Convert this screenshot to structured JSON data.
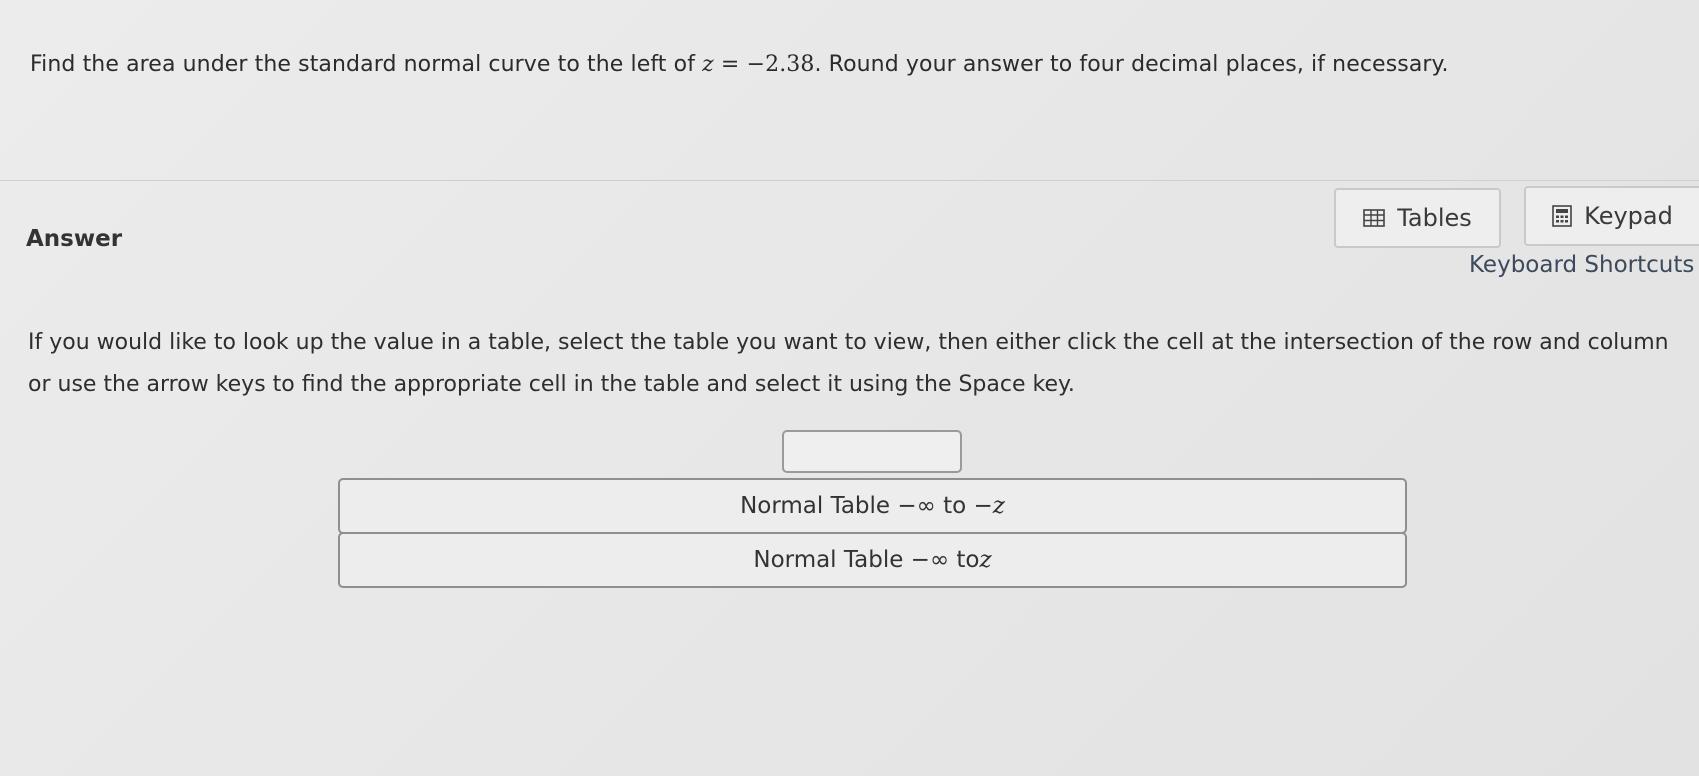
{
  "question": {
    "prefix": "Find the area under the standard normal curve to the left of ",
    "variable": "z",
    "equals": " = ",
    "value": "−2.38",
    "suffix": ". Round your answer to four decimal places, if necessary."
  },
  "answer_section": {
    "label": "Answer"
  },
  "toolbar": {
    "tables_label": "Tables",
    "tables_icon": "table-grid-icon",
    "keypad_label": "Keypad",
    "keypad_icon": "calculator-icon",
    "shortcuts_label": "Keyboard Shortcuts"
  },
  "instructions": {
    "text": "If you would like to look up the value in a table, select the table you want to view, then either click the cell at the intersection of the row and column or use the arrow keys to find the appropriate cell in the table and select it using the Space key."
  },
  "answer_input": {
    "value": ""
  },
  "table_options": [
    {
      "prefix": "Normal Table −∞ to −",
      "variable": "z"
    },
    {
      "prefix": "Normal Table −∞ to ",
      "variable": "z"
    }
  ]
}
